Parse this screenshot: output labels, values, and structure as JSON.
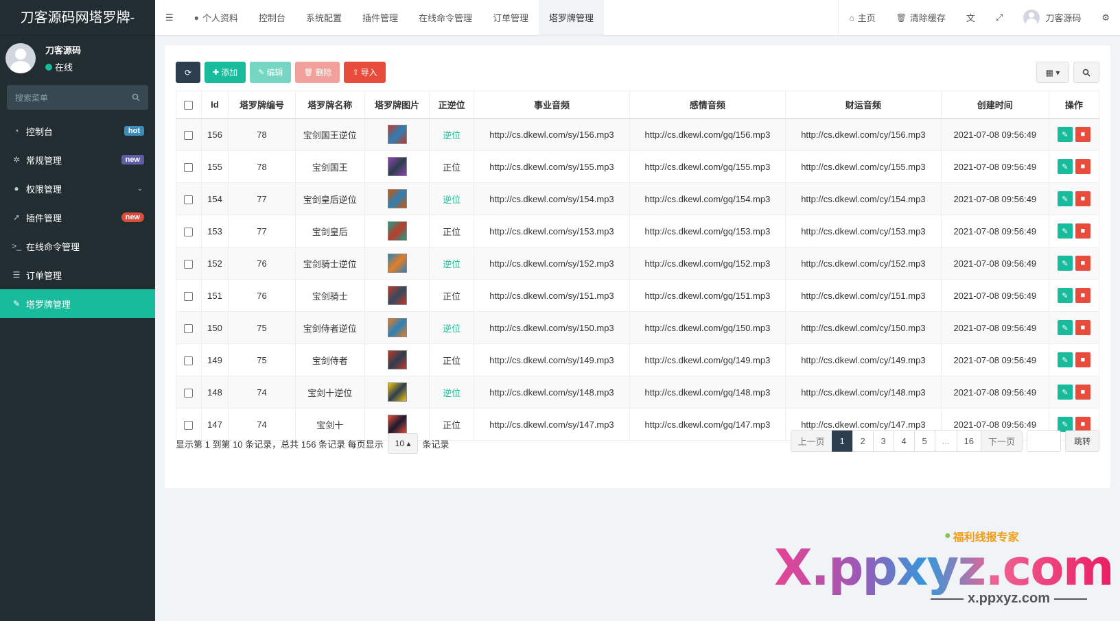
{
  "sidebar": {
    "logo": "刀客源码网塔罗牌-",
    "user": {
      "name": "刀客源码",
      "status": "在线"
    },
    "search_placeholder": "搜索菜单",
    "items": [
      {
        "icon": "dashboard-icon",
        "label": "控制台",
        "badge": "hot"
      },
      {
        "icon": "cogs-icon",
        "label": "常规管理",
        "badge": "new"
      },
      {
        "icon": "group-icon",
        "label": "权限管理",
        "badge": ""
      },
      {
        "icon": "rocket-icon",
        "label": "插件管理",
        "badge": "new"
      },
      {
        "icon": "terminal-icon",
        "label": "在线命令管理",
        "badge": ""
      },
      {
        "icon": "list-icon",
        "label": "订单管理",
        "badge": ""
      },
      {
        "icon": "paint-icon",
        "label": "塔罗牌管理",
        "badge": ""
      }
    ]
  },
  "navbar": {
    "tabs": [
      "个人资料",
      "控制台",
      "系统配置",
      "插件管理",
      "在线命令管理",
      "订单管理",
      "塔罗牌管理"
    ],
    "home": "主页",
    "clear_cache": "清除缓存",
    "user": "刀客源码"
  },
  "toolbar": {
    "add": "添加",
    "edit": "编辑",
    "delete": "删除",
    "import": "导入"
  },
  "table": {
    "headers": [
      "Id",
      "塔罗牌编号",
      "塔罗牌名称",
      "塔罗牌图片",
      "正逆位",
      "事业音频",
      "感情音频",
      "财运音频",
      "创建时间",
      "操作"
    ],
    "rows": [
      {
        "id": "156",
        "num": "78",
        "name": "宝剑国王逆位",
        "pos": "逆位",
        "sy": "http://cs.dkewl.com/sy/156.mp3",
        "gq": "http://cs.dkewl.com/gq/156.mp3",
        "cy": "http://cs.dkewl.com/cy/156.mp3",
        "time": "2021-07-08 09:56:49"
      },
      {
        "id": "155",
        "num": "78",
        "name": "宝剑国王",
        "pos": "正位",
        "sy": "http://cs.dkewl.com/sy/155.mp3",
        "gq": "http://cs.dkewl.com/gq/155.mp3",
        "cy": "http://cs.dkewl.com/cy/155.mp3",
        "time": "2021-07-08 09:56:49"
      },
      {
        "id": "154",
        "num": "77",
        "name": "宝剑皇后逆位",
        "pos": "逆位",
        "sy": "http://cs.dkewl.com/sy/154.mp3",
        "gq": "http://cs.dkewl.com/gq/154.mp3",
        "cy": "http://cs.dkewl.com/cy/154.mp3",
        "time": "2021-07-08 09:56:49"
      },
      {
        "id": "153",
        "num": "77",
        "name": "宝剑皇后",
        "pos": "正位",
        "sy": "http://cs.dkewl.com/sy/153.mp3",
        "gq": "http://cs.dkewl.com/gq/153.mp3",
        "cy": "http://cs.dkewl.com/cy/153.mp3",
        "time": "2021-07-08 09:56:49"
      },
      {
        "id": "152",
        "num": "76",
        "name": "宝剑骑士逆位",
        "pos": "逆位",
        "sy": "http://cs.dkewl.com/sy/152.mp3",
        "gq": "http://cs.dkewl.com/gq/152.mp3",
        "cy": "http://cs.dkewl.com/cy/152.mp3",
        "time": "2021-07-08 09:56:49"
      },
      {
        "id": "151",
        "num": "76",
        "name": "宝剑骑士",
        "pos": "正位",
        "sy": "http://cs.dkewl.com/sy/151.mp3",
        "gq": "http://cs.dkewl.com/gq/151.mp3",
        "cy": "http://cs.dkewl.com/cy/151.mp3",
        "time": "2021-07-08 09:56:49"
      },
      {
        "id": "150",
        "num": "75",
        "name": "宝剑侍者逆位",
        "pos": "逆位",
        "sy": "http://cs.dkewl.com/sy/150.mp3",
        "gq": "http://cs.dkewl.com/gq/150.mp3",
        "cy": "http://cs.dkewl.com/cy/150.mp3",
        "time": "2021-07-08 09:56:49"
      },
      {
        "id": "149",
        "num": "75",
        "name": "宝剑侍者",
        "pos": "正位",
        "sy": "http://cs.dkewl.com/sy/149.mp3",
        "gq": "http://cs.dkewl.com/gq/149.mp3",
        "cy": "http://cs.dkewl.com/cy/149.mp3",
        "time": "2021-07-08 09:56:49"
      },
      {
        "id": "148",
        "num": "74",
        "name": "宝剑十逆位",
        "pos": "逆位",
        "sy": "http://cs.dkewl.com/sy/148.mp3",
        "gq": "http://cs.dkewl.com/gq/148.mp3",
        "cy": "http://cs.dkewl.com/cy/148.mp3",
        "time": "2021-07-08 09:56:49"
      },
      {
        "id": "147",
        "num": "74",
        "name": "宝剑十",
        "pos": "正位",
        "sy": "http://cs.dkewl.com/sy/147.mp3",
        "gq": "http://cs.dkewl.com/gq/147.mp3",
        "cy": "http://cs.dkewl.com/cy/147.mp3",
        "time": "2021-07-08 09:56:49"
      }
    ]
  },
  "pagination": {
    "info_prefix": "显示第 1 到第 10 条记录，总共 156 条记录 每页显示",
    "page_size": "10",
    "info_suffix": "条记录",
    "prev": "上一页",
    "pages": [
      "1",
      "2",
      "3",
      "4",
      "5",
      "...",
      "16"
    ],
    "current": "1",
    "next": "下一页",
    "jump": "跳转"
  },
  "watermark": {
    "big": "X.ppxyz.com",
    "small": "福利线报专家",
    "sub": "x.ppxyz.com"
  },
  "colors": {
    "sidebar": "#222d32",
    "accent": "#18bc9c",
    "danger": "#e74c3c",
    "dark": "#2c3e50"
  }
}
